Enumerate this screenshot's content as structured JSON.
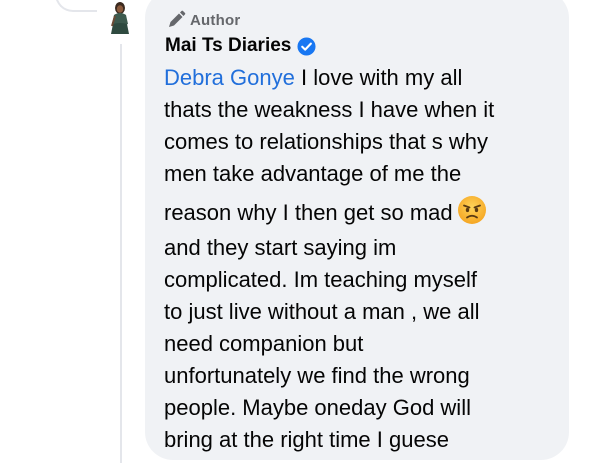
{
  "comment": {
    "badge_label": "Author",
    "author_name": "Mai Ts Diaries",
    "mention": "Debra Gonye",
    "first_line_rest": " I love with my all",
    "lines": [
      "thats the weakness I have when it",
      "comes to relationships that s why",
      "men take advantage of me the"
    ],
    "emoji_line": "reason why I then get so mad",
    "lines_after": [
      "and they start saying im",
      "complicated.  Im teaching myself",
      "to just live without a man , we all",
      "need companion but",
      "unfortunately we find the wrong",
      "people.  Maybe oneday God will",
      "bring at the right time I guese"
    ],
    "emoji": "angry-face-icon"
  },
  "colors": {
    "bubble": "#f0f2f5",
    "mention": "#216fdb",
    "verified": "#1877f2",
    "badge_text": "#65676b"
  }
}
